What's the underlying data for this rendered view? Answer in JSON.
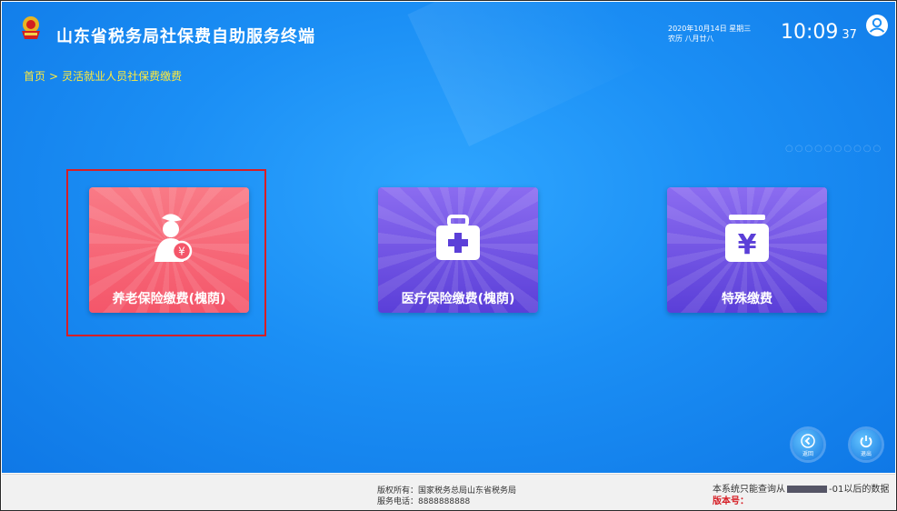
{
  "header": {
    "title": "山东省税务局社保费自助服务终端",
    "date_line": "2020年10月14日 星期三",
    "lunar_line": "农历 八月廿八",
    "time_hm": "10:09",
    "time_s": "37"
  },
  "breadcrumb": {
    "home": "首页",
    "separator": ">",
    "current": "灵活就业人员社保费缴费"
  },
  "tiles": [
    {
      "label": "养老保险缴费(槐荫)",
      "icon": "elder-person-yuan-icon",
      "color": "#f4566a"
    },
    {
      "label": "医疗保险缴费(槐荫)",
      "icon": "medical-kit-icon",
      "color": "#5b3fd8"
    },
    {
      "label": "特殊缴费",
      "icon": "yuan-box-icon",
      "color": "#5b3fd8"
    }
  ],
  "nav": {
    "back_label": "返回",
    "exit_label": "退出"
  },
  "footer": {
    "copyright": "版权所有：国家税务总局山东省税务局",
    "phone": "服务电话：8888888888",
    "notice_prefix": "本系统只能查询从",
    "notice_suffix": "-01以后的数据",
    "version_label": "版本号："
  }
}
